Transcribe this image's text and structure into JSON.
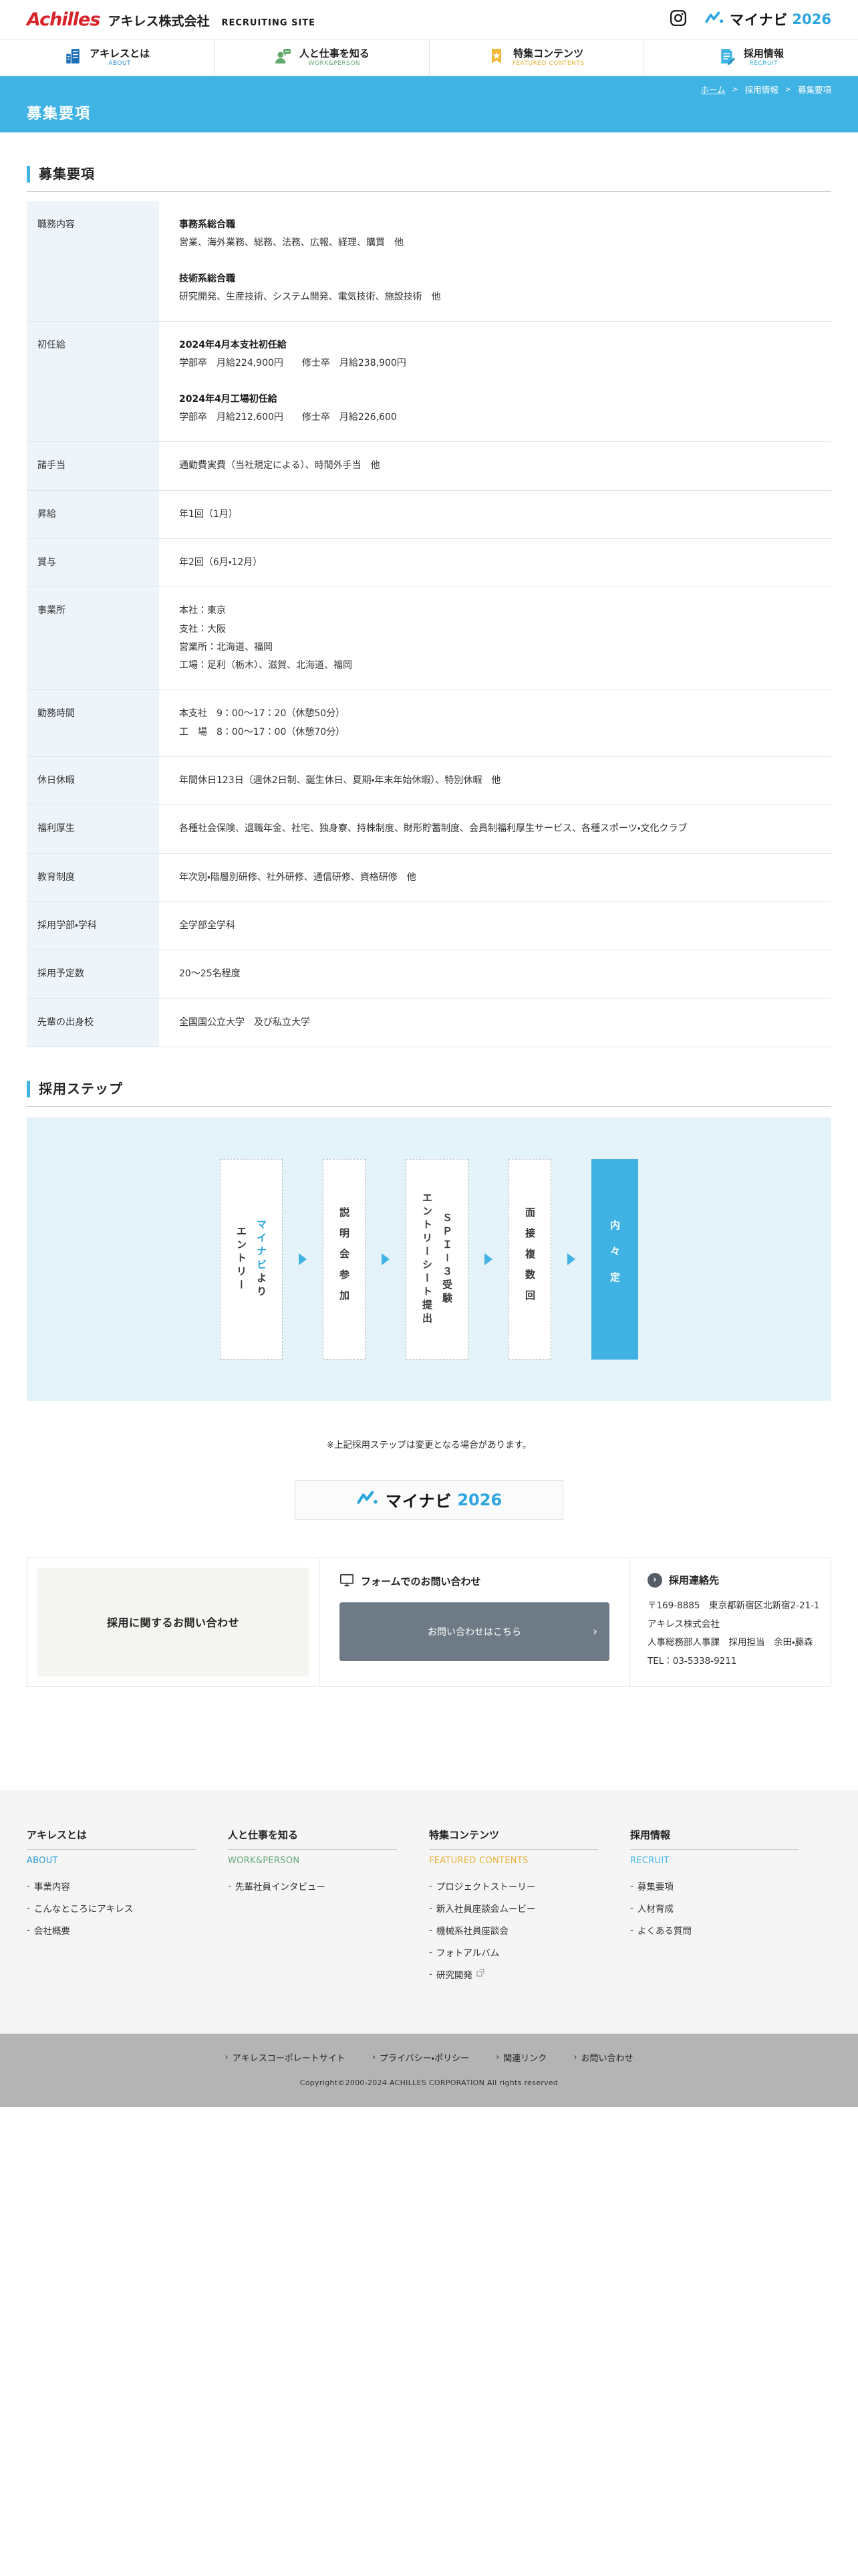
{
  "colors": {
    "accent_blue": "#3fb3e4",
    "logo_red": "#d8232a",
    "mynavi_blue": "#2ca6e0",
    "step_filled": "#3fb1e3",
    "button_slate": "#6e7a85"
  },
  "header": {
    "logo_en": "Achilles",
    "logo_jp": "アキレス株式会社",
    "logo_suffix": "RECRUITING SITE",
    "mynavi_text": "マイナビ",
    "mynavi_year": "2026"
  },
  "nav": {
    "items": [
      {
        "id": "about",
        "label": "アキレスとは",
        "sub": "ABOUT",
        "color": "#2b8fce",
        "icon": "building-icon"
      },
      {
        "id": "work",
        "label": "人と仕事を知る",
        "sub": "WORK&PERSON",
        "color": "#67a872",
        "icon": "person-speech-icon"
      },
      {
        "id": "features",
        "label": "特集コンテンツ",
        "sub": "FEATURED CONTENTS",
        "color": "#e9b43c",
        "icon": "bookmark-star-icon"
      },
      {
        "id": "recruit",
        "label": "採用情報",
        "sub": "RECRUIT",
        "color": "#41b5e5",
        "icon": "document-pen-icon"
      }
    ]
  },
  "banner": {
    "title": "募集要項",
    "breadcrumb": [
      {
        "label": "ホーム",
        "link": true
      },
      {
        "label": "採用情報",
        "link": false
      },
      {
        "label": "募集要項",
        "link": false
      }
    ]
  },
  "requirements": {
    "section_title": "募集要項",
    "rows": [
      {
        "label": "職務内容",
        "groups": [
          {
            "heading": "事務系総合職",
            "text": "営業、海外業務、総務、法務、広報、経理、購買　他"
          },
          {
            "heading": "技術系総合職",
            "text": "研究開発、生産技術、システム開発、電気技術、施設技術　他"
          }
        ]
      },
      {
        "label": "初任給",
        "groups": [
          {
            "heading": "2024年4月本支社初任給",
            "text": "学部卒　月給224,900円　　修士卒　月給238,900円"
          },
          {
            "heading": "2024年4月工場初任給",
            "text": "学部卒　月給212,600円　　修士卒　月給226,600"
          }
        ]
      },
      {
        "label": "諸手当",
        "text": "通勤費実費（当社規定による）、時間外手当　他"
      },
      {
        "label": "昇給",
        "text": "年1回（1月）"
      },
      {
        "label": "賞与",
        "text": "年2回（6月・12月）"
      },
      {
        "label": "事業所",
        "lines": [
          "本社：東京",
          "支社：大阪",
          "営業所：北海道、福岡",
          "工場：足利（栃木）、滋賀、北海道、福岡"
        ]
      },
      {
        "label": "勤務時間",
        "lines": [
          "本支社　9：00～17：20（休憩50分）",
          "工　場　8：00～17：00（休憩70分）"
        ]
      },
      {
        "label": "休日休暇",
        "text": "年間休日123日（週休2日制、誕生休日、夏期・年末年始休暇）、特別休暇　他"
      },
      {
        "label": "福利厚生",
        "text": "各種社会保険、退職年金、社宅、独身寮、持株制度、財形貯蓄制度、会員制福利厚生サービス、各種スポーツ・文化クラブ"
      },
      {
        "label": "教育制度",
        "text": "年次別・階層別研修、社外研修、通信研修、資格研修　他"
      },
      {
        "label": "採用学部・学科",
        "text": "全学部全学科"
      },
      {
        "label": "採用予定数",
        "text": "20～25名程度"
      },
      {
        "label": "先輩の出身校",
        "text": "全国国公立大学　及び私立大学"
      }
    ]
  },
  "steps": {
    "section_title": "採用ステップ",
    "items": [
      {
        "name": "entry",
        "filled": false,
        "lines": [
          [
            {
              "t": "マイナビ",
              "c": "#2ca6e0"
            },
            {
              "t": "より"
            }
          ],
          [
            {
              "t": "エントリー"
            }
          ]
        ]
      },
      {
        "name": "seminar",
        "filled": false,
        "lines": [
          [
            {
              "t": "説明会参加"
            }
          ]
        ]
      },
      {
        "name": "entrysheet-spi",
        "filled": false,
        "lines": [
          [
            {
              "t": "ＳＰＩ－３受験"
            }
          ],
          [
            {
              "t": "エントリーシート提出"
            }
          ]
        ]
      },
      {
        "name": "interview",
        "filled": false,
        "lines": [
          [
            {
              "t": "面接複数回"
            }
          ]
        ]
      },
      {
        "name": "offer",
        "filled": true,
        "lines": [
          [
            {
              "t": "内々定"
            }
          ]
        ]
      }
    ],
    "note": "※上記採用ステップは変更となる場合があります。",
    "mynavi_button": {
      "text": "マイナビ",
      "year": "2026"
    }
  },
  "contact": {
    "left_title": "採用に関するお問い合わせ",
    "form_heading": "フォームでのお問い合わせ",
    "form_button": "お問い合わせはこちら",
    "form_button_chevron": "›",
    "info_heading": "採用連絡先",
    "info_chevron": "›",
    "info_lines": [
      "〒169-8885　東京都新宿区北新宿2-21-1",
      "アキレス株式会社",
      "人事総務部人事課　採用担当　余田・藤森",
      "TEL：03-5338-9211"
    ]
  },
  "footer": {
    "columns": [
      {
        "title": "アキレスとは",
        "sub": "ABOUT",
        "sub_color": "#2b9fd8",
        "links": [
          {
            "label": "事業内容"
          },
          {
            "label": "こんなところにアキレス"
          },
          {
            "label": "会社概要"
          }
        ]
      },
      {
        "title": "人と仕事を知る",
        "sub": "WORK&PERSON",
        "sub_color": "#67a872",
        "links": [
          {
            "label": "先輩社員インタビュー"
          }
        ]
      },
      {
        "title": "特集コンテンツ",
        "sub": "FEATURED CONTENTS",
        "sub_color": "#e9b43c",
        "links": [
          {
            "label": "プロジェクトストーリー"
          },
          {
            "label": "新入社員座談会ムービー"
          },
          {
            "label": "機械系社員座談会"
          },
          {
            "label": "フォトアルバム"
          },
          {
            "label": "研究開発",
            "external": true
          }
        ]
      },
      {
        "title": "採用情報",
        "sub": "RECRUIT",
        "sub_color": "#41b5e5",
        "links": [
          {
            "label": "募集要項"
          },
          {
            "label": "人材育成"
          },
          {
            "label": "よくある質問"
          }
        ]
      }
    ]
  },
  "bottom": {
    "links": [
      "アキレスコーポレートサイト",
      "プライバシー・ポリシー",
      "関連リンク",
      "お問い合わせ"
    ],
    "marker": "›",
    "copyright": "Copyright©2000-2024 ACHILLES CORPORATION All rights reserved"
  }
}
